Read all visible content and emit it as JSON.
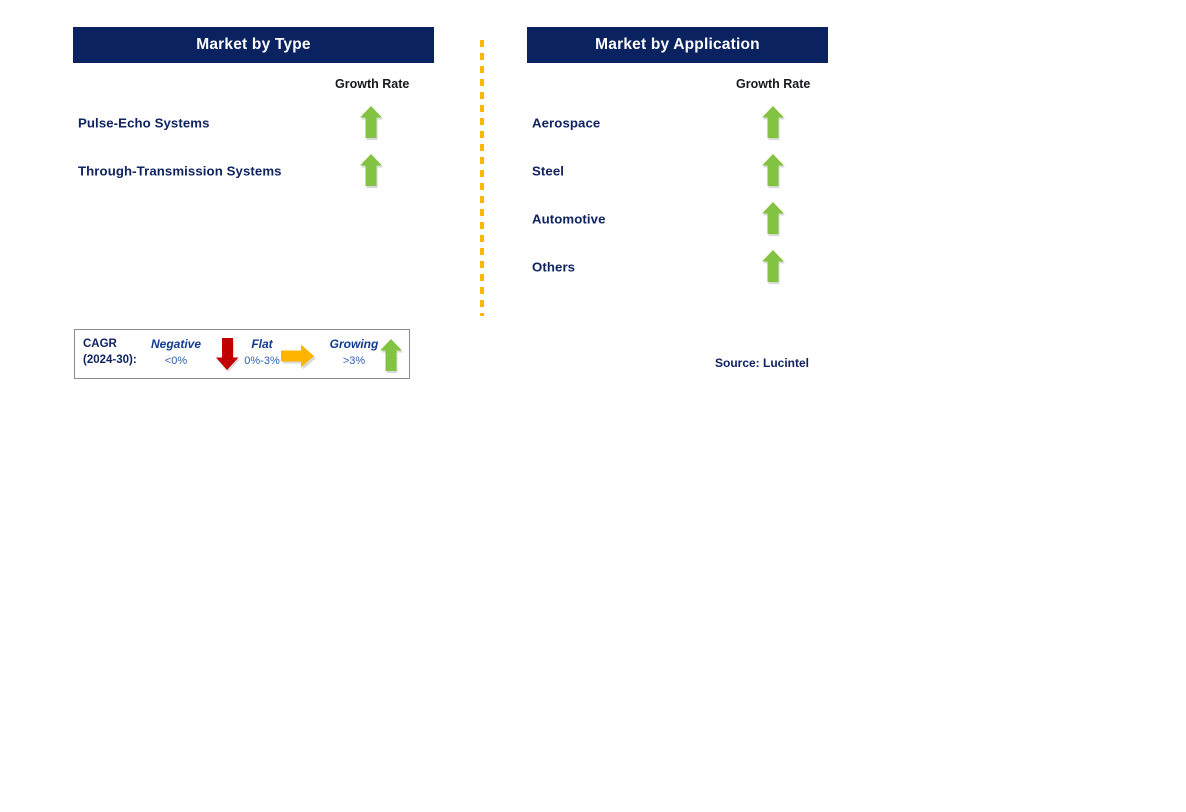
{
  "divider": {
    "color": "#ffb700",
    "style": "dashed-vertical"
  },
  "panels": [
    {
      "id": "market-by-type",
      "header": "Market by Type",
      "growth_rate_label": "Growth Rate",
      "rows": [
        {
          "label": "Pulse-Echo Systems",
          "growth": "growing",
          "icon": "arrow-up-icon"
        },
        {
          "label": "Through-Transmission Systems",
          "growth": "growing",
          "icon": "arrow-up-icon"
        }
      ]
    },
    {
      "id": "market-by-application",
      "header": "Market by Application",
      "growth_rate_label": "Growth Rate",
      "rows": [
        {
          "label": "Aerospace",
          "growth": "growing",
          "icon": "arrow-up-icon"
        },
        {
          "label": "Steel",
          "growth": "growing",
          "icon": "arrow-up-icon"
        },
        {
          "label": "Automotive",
          "growth": "growing",
          "icon": "arrow-up-icon"
        },
        {
          "label": "Others",
          "growth": "growing",
          "icon": "arrow-up-icon"
        }
      ]
    }
  ],
  "legend": {
    "title_line1": "CAGR",
    "title_line2": "(2024-30):",
    "items": [
      {
        "word": "Negative",
        "range": "<0%",
        "icon": "arrow-down-icon",
        "color": "#c00000"
      },
      {
        "word": "Flat",
        "range": "0%-3%",
        "icon": "arrow-right-icon",
        "color": "#ffb400"
      },
      {
        "word": "Growing",
        "range": ">3%",
        "icon": "arrow-up-icon",
        "color": "#82c341"
      }
    ]
  },
  "source": "Source: Lucintel",
  "colors": {
    "header_bg": "#0a2260",
    "header_text": "#ffffff",
    "label_text": "#0f2360",
    "growing": "#82c341",
    "negative": "#c00000",
    "flat": "#ffb400",
    "divider": "#ffb700",
    "legend_border": "#8c8c8c"
  }
}
